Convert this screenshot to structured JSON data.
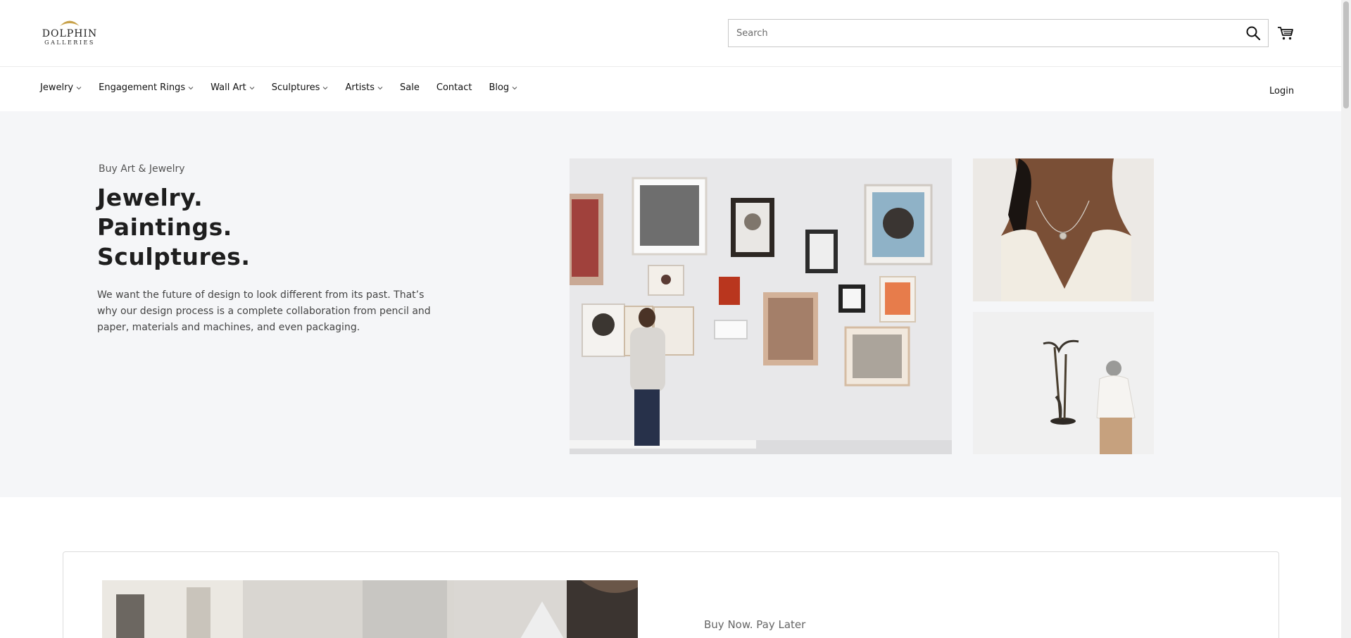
{
  "brand": {
    "name": "DOLPHIN",
    "subname": "GALLERIES",
    "accent_color": "#c8a24a"
  },
  "search": {
    "placeholder": "Search",
    "icon": "search-icon"
  },
  "cart": {
    "icon": "cart-icon"
  },
  "nav": {
    "items": [
      {
        "label": "Jewelry",
        "has_dropdown": true
      },
      {
        "label": "Engagement Rings",
        "has_dropdown": true
      },
      {
        "label": "Wall Art",
        "has_dropdown": true
      },
      {
        "label": "Sculptures",
        "has_dropdown": true
      },
      {
        "label": "Artists",
        "has_dropdown": true
      },
      {
        "label": "Sale",
        "has_dropdown": false
      },
      {
        "label": "Contact",
        "has_dropdown": false
      },
      {
        "label": "Blog",
        "has_dropdown": true
      }
    ],
    "login": "Login"
  },
  "hero": {
    "eyebrow": "Buy Art & Jewelry",
    "headline": [
      "Jewelry.",
      "Paintings.",
      "Sculptures."
    ],
    "body": "We want the future of design to look different from its past. That’s why our design process is a complete collaboration from pencil and paper, materials and machines, and even packaging.",
    "background": "#f5f6f8"
  },
  "promo": {
    "eyebrow": "Buy Now. Pay Later"
  }
}
